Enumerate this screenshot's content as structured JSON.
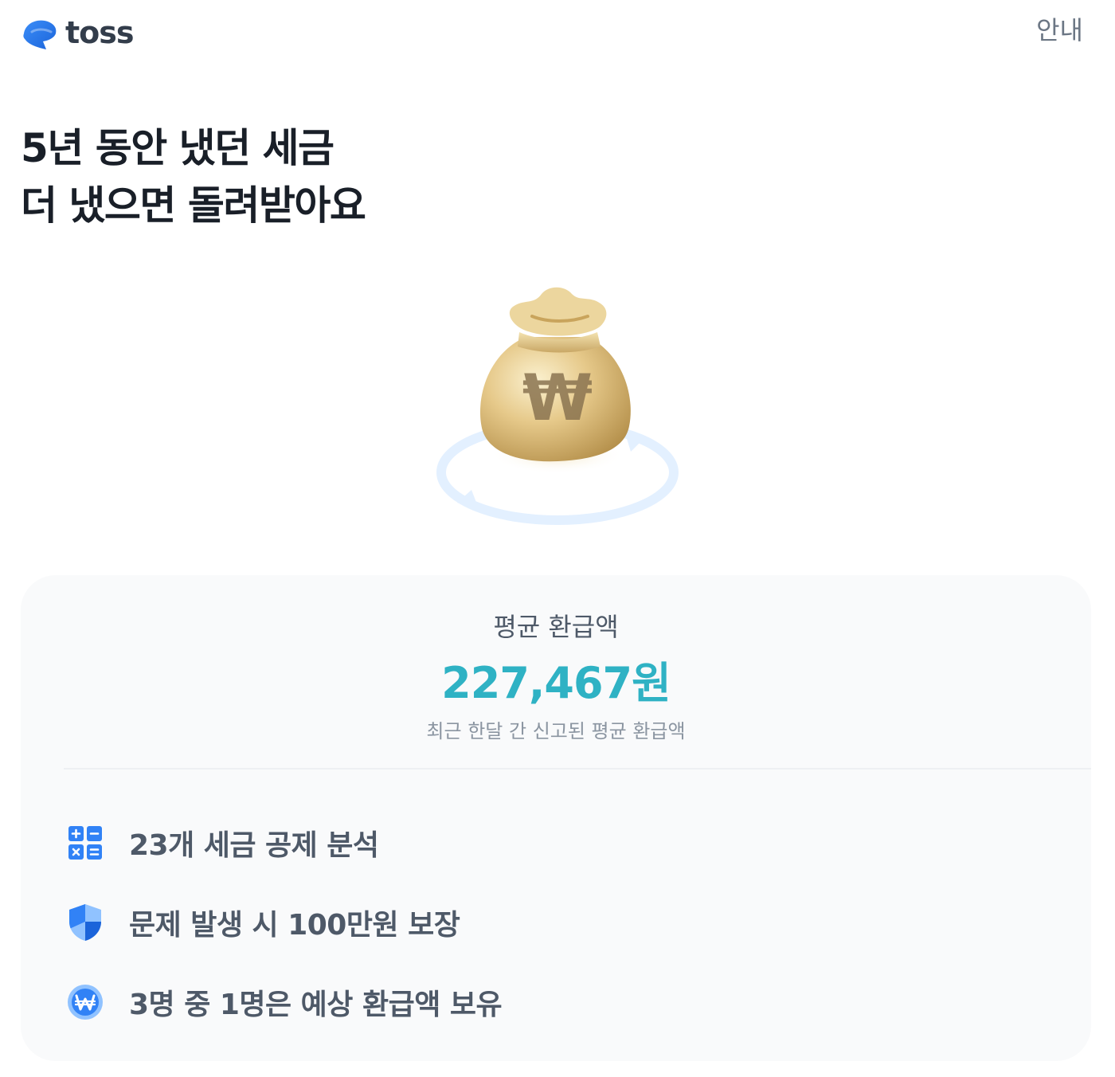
{
  "header": {
    "logo_text": "toss",
    "info_label": "안내"
  },
  "headline": {
    "line1": "5년 동안 냈던 세금",
    "line2": "더 냈으면 돌려받아요"
  },
  "illustration": {
    "icon": "money-bag-icon",
    "symbol": "₩"
  },
  "summary": {
    "label": "평균 환급액",
    "value": "227,467원",
    "caption": "최근 한달 간 신고된 평균 환급액",
    "value_color": "#2fb2c4"
  },
  "features": [
    {
      "icon": "calculator-icon",
      "text": "23개 세금 공제 분석"
    },
    {
      "icon": "shield-icon",
      "text": "문제 발생 시 100만원 보장"
    },
    {
      "icon": "won-coin-icon",
      "text": "3명 중 1명은 예상 환급액 보유"
    }
  ],
  "colors": {
    "brand_blue": "#3182f6",
    "text_primary": "#191f28",
    "text_secondary": "#4e5968",
    "card_background": "#f9fafb"
  }
}
